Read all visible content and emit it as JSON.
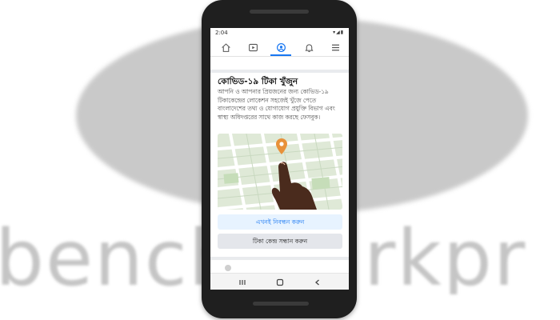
{
  "background": {
    "watermark_text": "benchmarkpr",
    "logo_color": "#c9c9c9"
  },
  "status_bar": {
    "time": "2:04",
    "icons": "▾◢▮"
  },
  "nav": {
    "items": [
      {
        "icon": "home-icon"
      },
      {
        "icon": "video-icon"
      },
      {
        "icon": "groups-icon",
        "active": true
      },
      {
        "icon": "bell-icon"
      },
      {
        "icon": "menu-icon"
      }
    ],
    "accent_color": "#1877f2"
  },
  "card": {
    "title": "কোভিড-১৯ টিকা খুঁজুন",
    "description": "আপনি ও আপনার প্রিয়জনের জন্য কোভিড-১৯ টিকাকেন্দ্রের লোকেশন সহজেই খুঁজে পেতে বাংলাদেশের তথ্য ও যোগাযোগ প্রযুক্তি বিভাগ এবং স্বাস্থ্য অধিদপ্তরের সাথে কাজ করছে ফেসবুক।",
    "illustration": "map-with-pin-and-hand",
    "register_button": "এখনই নিবন্ধন করুন",
    "find_center_button": "টিকা কেন্দ্র সন্ধান করুন"
  },
  "android_nav": {
    "recent": "recent-apps-icon",
    "home": "home-circle-icon",
    "back": "back-icon"
  }
}
